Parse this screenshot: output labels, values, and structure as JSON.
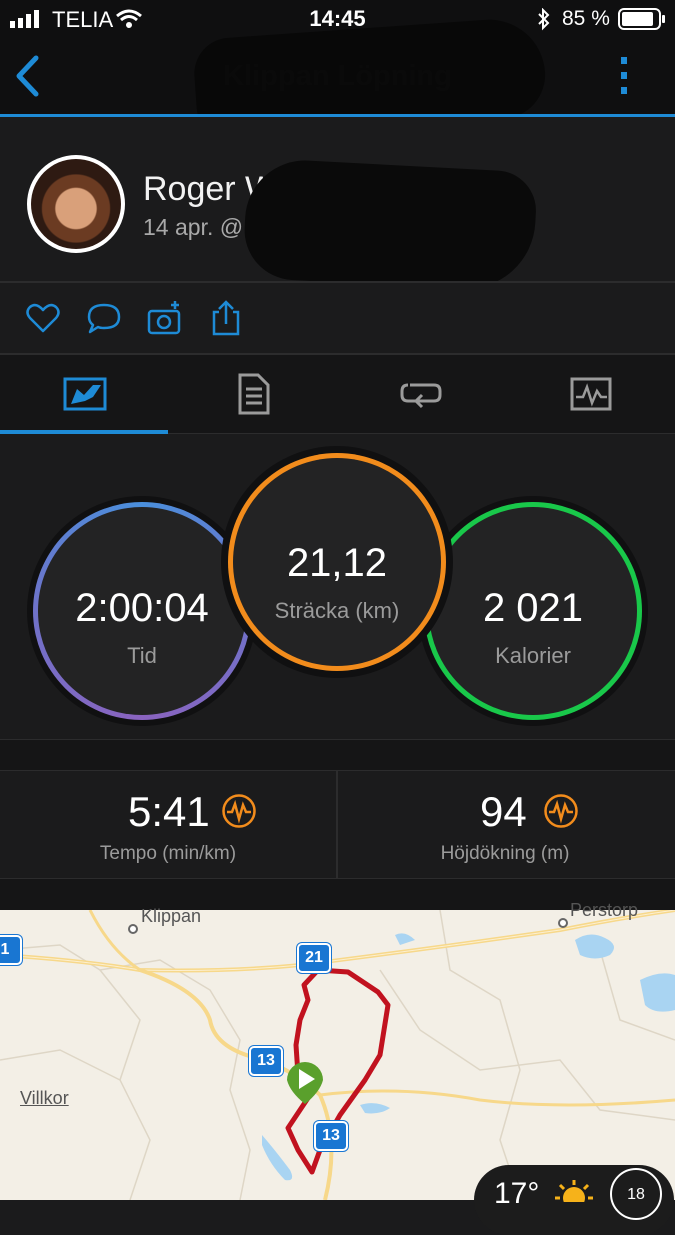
{
  "status_bar": {
    "carrier": "TELIA",
    "time": "14:45",
    "battery": "85 %"
  },
  "nav": {
    "title": "Klippan Löpning"
  },
  "profile": {
    "name": "Roger Wilhelmsson",
    "date": "14 apr. @ 12:17 - 14:17"
  },
  "tabs": [
    {
      "icon": "overview-icon",
      "active": true
    },
    {
      "icon": "details-icon",
      "active": false
    },
    {
      "icon": "laps-icon",
      "active": false
    },
    {
      "icon": "graph-icon",
      "active": false
    }
  ],
  "summary": {
    "time": {
      "value": "2:00:04",
      "label": "Tid"
    },
    "distance": {
      "value": "21,12",
      "label": "Sträcka (km)"
    },
    "calories": {
      "value": "2 021",
      "label": "Kalorier"
    }
  },
  "stats": {
    "pace": {
      "value": "5:41",
      "label": "Tempo (min/km)"
    },
    "elevation": {
      "value": "94",
      "label": "Höjdökning (m)"
    }
  },
  "map": {
    "places": {
      "klippan": "Klippan",
      "perstorp": "Perstorp",
      "villkor": "Villkor"
    },
    "roads": {
      "r21a": "21",
      "r13a": "13",
      "r13b": "13",
      "r1": "1"
    },
    "weather": {
      "temp": "17°",
      "wind": "18"
    },
    "colors": {
      "route": "#c1121f",
      "start": "#5aa02c"
    }
  },
  "colors": {
    "accent": "#1e8bd6",
    "time_ring": "#4a8fdc",
    "distance_ring": "#f28c1c",
    "calories_ring": "#19c84a"
  }
}
